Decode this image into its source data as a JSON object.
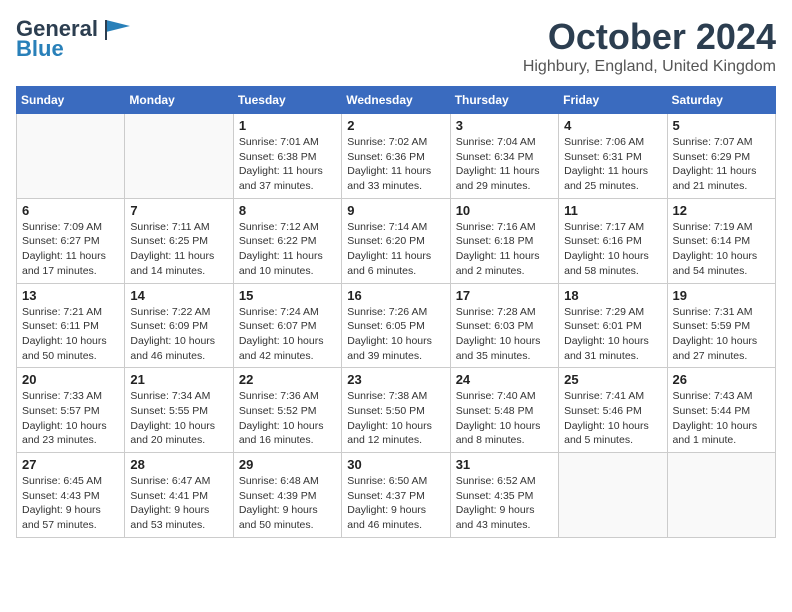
{
  "header": {
    "logo_line1": "General",
    "logo_line2": "Blue",
    "month_title": "October 2024",
    "location": "Highbury, England, United Kingdom"
  },
  "days_of_week": [
    "Sunday",
    "Monday",
    "Tuesday",
    "Wednesday",
    "Thursday",
    "Friday",
    "Saturday"
  ],
  "weeks": [
    [
      {
        "day": "",
        "info": ""
      },
      {
        "day": "",
        "info": ""
      },
      {
        "day": "1",
        "info": "Sunrise: 7:01 AM\nSunset: 6:38 PM\nDaylight: 11 hours\nand 37 minutes."
      },
      {
        "day": "2",
        "info": "Sunrise: 7:02 AM\nSunset: 6:36 PM\nDaylight: 11 hours\nand 33 minutes."
      },
      {
        "day": "3",
        "info": "Sunrise: 7:04 AM\nSunset: 6:34 PM\nDaylight: 11 hours\nand 29 minutes."
      },
      {
        "day": "4",
        "info": "Sunrise: 7:06 AM\nSunset: 6:31 PM\nDaylight: 11 hours\nand 25 minutes."
      },
      {
        "day": "5",
        "info": "Sunrise: 7:07 AM\nSunset: 6:29 PM\nDaylight: 11 hours\nand 21 minutes."
      }
    ],
    [
      {
        "day": "6",
        "info": "Sunrise: 7:09 AM\nSunset: 6:27 PM\nDaylight: 11 hours\nand 17 minutes."
      },
      {
        "day": "7",
        "info": "Sunrise: 7:11 AM\nSunset: 6:25 PM\nDaylight: 11 hours\nand 14 minutes."
      },
      {
        "day": "8",
        "info": "Sunrise: 7:12 AM\nSunset: 6:22 PM\nDaylight: 11 hours\nand 10 minutes."
      },
      {
        "day": "9",
        "info": "Sunrise: 7:14 AM\nSunset: 6:20 PM\nDaylight: 11 hours\nand 6 minutes."
      },
      {
        "day": "10",
        "info": "Sunrise: 7:16 AM\nSunset: 6:18 PM\nDaylight: 11 hours\nand 2 minutes."
      },
      {
        "day": "11",
        "info": "Sunrise: 7:17 AM\nSunset: 6:16 PM\nDaylight: 10 hours\nand 58 minutes."
      },
      {
        "day": "12",
        "info": "Sunrise: 7:19 AM\nSunset: 6:14 PM\nDaylight: 10 hours\nand 54 minutes."
      }
    ],
    [
      {
        "day": "13",
        "info": "Sunrise: 7:21 AM\nSunset: 6:11 PM\nDaylight: 10 hours\nand 50 minutes."
      },
      {
        "day": "14",
        "info": "Sunrise: 7:22 AM\nSunset: 6:09 PM\nDaylight: 10 hours\nand 46 minutes."
      },
      {
        "day": "15",
        "info": "Sunrise: 7:24 AM\nSunset: 6:07 PM\nDaylight: 10 hours\nand 42 minutes."
      },
      {
        "day": "16",
        "info": "Sunrise: 7:26 AM\nSunset: 6:05 PM\nDaylight: 10 hours\nand 39 minutes."
      },
      {
        "day": "17",
        "info": "Sunrise: 7:28 AM\nSunset: 6:03 PM\nDaylight: 10 hours\nand 35 minutes."
      },
      {
        "day": "18",
        "info": "Sunrise: 7:29 AM\nSunset: 6:01 PM\nDaylight: 10 hours\nand 31 minutes."
      },
      {
        "day": "19",
        "info": "Sunrise: 7:31 AM\nSunset: 5:59 PM\nDaylight: 10 hours\nand 27 minutes."
      }
    ],
    [
      {
        "day": "20",
        "info": "Sunrise: 7:33 AM\nSunset: 5:57 PM\nDaylight: 10 hours\nand 23 minutes."
      },
      {
        "day": "21",
        "info": "Sunrise: 7:34 AM\nSunset: 5:55 PM\nDaylight: 10 hours\nand 20 minutes."
      },
      {
        "day": "22",
        "info": "Sunrise: 7:36 AM\nSunset: 5:52 PM\nDaylight: 10 hours\nand 16 minutes."
      },
      {
        "day": "23",
        "info": "Sunrise: 7:38 AM\nSunset: 5:50 PM\nDaylight: 10 hours\nand 12 minutes."
      },
      {
        "day": "24",
        "info": "Sunrise: 7:40 AM\nSunset: 5:48 PM\nDaylight: 10 hours\nand 8 minutes."
      },
      {
        "day": "25",
        "info": "Sunrise: 7:41 AM\nSunset: 5:46 PM\nDaylight: 10 hours\nand 5 minutes."
      },
      {
        "day": "26",
        "info": "Sunrise: 7:43 AM\nSunset: 5:44 PM\nDaylight: 10 hours\nand 1 minute."
      }
    ],
    [
      {
        "day": "27",
        "info": "Sunrise: 6:45 AM\nSunset: 4:43 PM\nDaylight: 9 hours\nand 57 minutes."
      },
      {
        "day": "28",
        "info": "Sunrise: 6:47 AM\nSunset: 4:41 PM\nDaylight: 9 hours\nand 53 minutes."
      },
      {
        "day": "29",
        "info": "Sunrise: 6:48 AM\nSunset: 4:39 PM\nDaylight: 9 hours\nand 50 minutes."
      },
      {
        "day": "30",
        "info": "Sunrise: 6:50 AM\nSunset: 4:37 PM\nDaylight: 9 hours\nand 46 minutes."
      },
      {
        "day": "31",
        "info": "Sunrise: 6:52 AM\nSunset: 4:35 PM\nDaylight: 9 hours\nand 43 minutes."
      },
      {
        "day": "",
        "info": ""
      },
      {
        "day": "",
        "info": ""
      }
    ]
  ]
}
